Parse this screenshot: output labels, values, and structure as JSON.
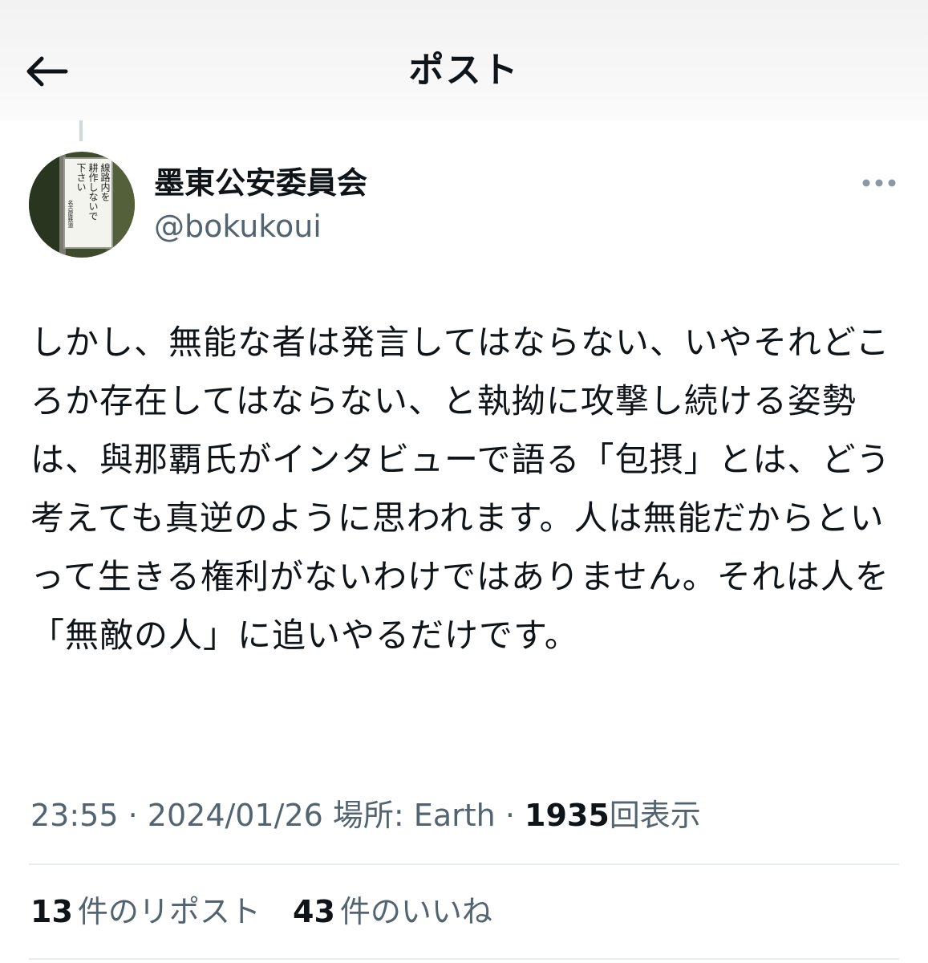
{
  "header": {
    "title": "ポスト",
    "back_icon": "arrow-left-icon"
  },
  "author": {
    "name": "墨東公安委員会",
    "handle": "@bokukoui",
    "avatar_sign_text": [
      "線路内を",
      "耕作しないで",
      "下さい"
    ],
    "avatar_sign_footer": "名古屋鉄道",
    "more_icon": "ellipsis-icon"
  },
  "post": {
    "text": "しかし、無能な者は発言してはならない、いやそれどころか存在してはならない、と執拗に攻撃し続ける姿勢は、與那覇氏がインタビューで語る「包摂」とは、どう考えても真逆のように思われます。人は無能だからといって生きる権利がないわけではありません。それは人を「無敵の人」に追いやるだけです。"
  },
  "meta": {
    "time": "23:55",
    "sep": "·",
    "date": "2024/01/26",
    "location": "場所: Earth",
    "views_count": "1935",
    "views_label": "回表示"
  },
  "stats": {
    "reposts_count": "13",
    "reposts_label": "件のリポスト",
    "likes_count": "43",
    "likes_label": "件のいいね"
  },
  "colors": {
    "text": "#0f1419",
    "secondary": "#536471",
    "divider": "#e6ecf0"
  }
}
